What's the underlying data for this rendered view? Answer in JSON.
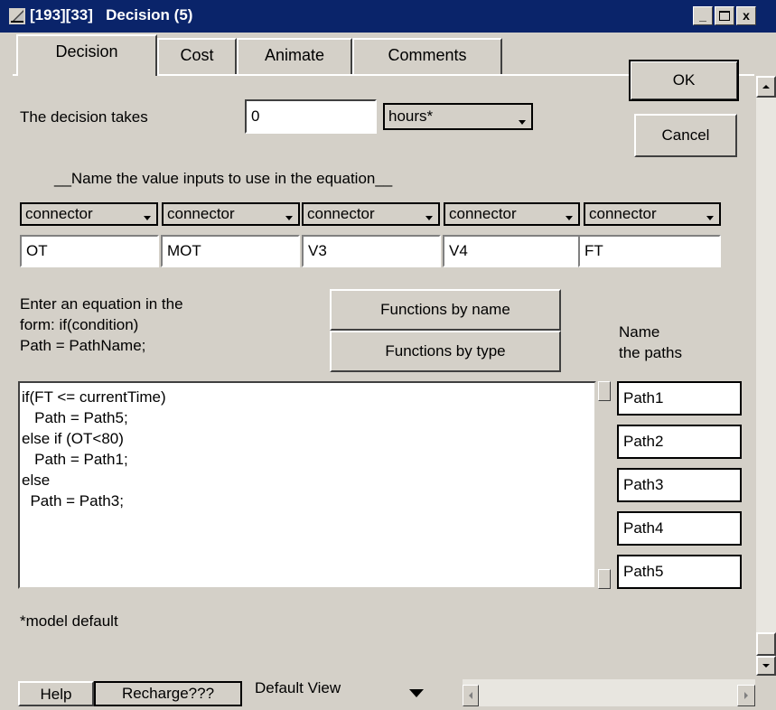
{
  "window": {
    "title": "[193][33]   Decision (5)",
    "controls": {
      "minimize": "_",
      "maximize": "□",
      "close": "x"
    }
  },
  "tabs": [
    {
      "label": "Decision",
      "active": true
    },
    {
      "label": "Cost",
      "active": false
    },
    {
      "label": "Animate",
      "active": false
    },
    {
      "label": "Comments",
      "active": false
    }
  ],
  "buttons": {
    "ok": "OK",
    "cancel": "Cancel"
  },
  "duration": {
    "label": "The decision takes",
    "value": "0",
    "unit": "hours*"
  },
  "inputs_heading": "__Name the value inputs to use in the equation__",
  "connectors": [
    {
      "type": "connector",
      "name": "OT"
    },
    {
      "type": "connector",
      "name": "MOT"
    },
    {
      "type": "connector",
      "name": "V3"
    },
    {
      "type": "connector",
      "name": "V4"
    },
    {
      "type": "connector",
      "name": "FT"
    }
  ],
  "equation_help": {
    "line1": "Enter an equation in the",
    "line2": "form: if(condition)",
    "line3": "Path = PathName;"
  },
  "function_buttons": {
    "by_name": "Functions by name",
    "by_type": "Functions by type"
  },
  "paths_heading": {
    "line1": "Name",
    "line2": "the paths"
  },
  "equation_lines": [
    "if(FT <= currentTime)",
    "   Path = Path5;",
    "else if (OT<80)",
    "   Path = Path1;",
    "else",
    "  Path = Path3;"
  ],
  "paths": [
    "Path1",
    "Path2",
    "Path3",
    "Path4",
    "Path5"
  ],
  "footnote": "*model default",
  "statusbar": {
    "help": "Help",
    "recharge": "Recharge???",
    "view": "Default View"
  },
  "colors": {
    "titlebar": "#0a246a",
    "face": "#d4d0c8"
  }
}
